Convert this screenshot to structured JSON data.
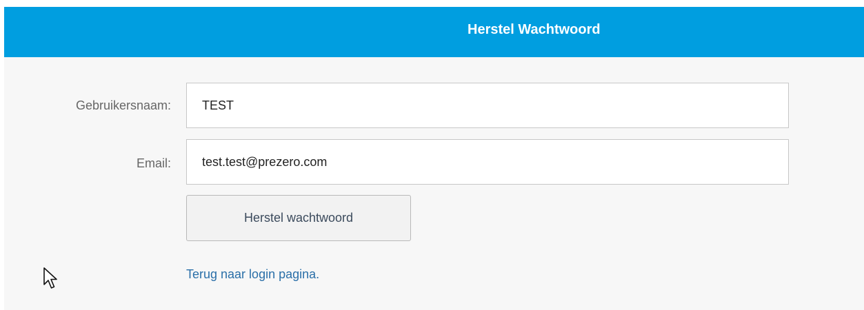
{
  "header": {
    "title": "Herstel Wachtwoord"
  },
  "form": {
    "username_label": "Gebruikersnaam:",
    "username_value": "TEST",
    "email_label": "Email:",
    "email_value": "test.test@prezero.com",
    "submit_label": "Herstel wachtwoord",
    "back_link_label": "Terug naar login pagina."
  },
  "colors": {
    "header_bg": "#009ee0",
    "page_bg": "#f7f7f7",
    "link": "#2a6fa8"
  },
  "icons": {
    "pointer": "mouse-pointer-icon"
  }
}
